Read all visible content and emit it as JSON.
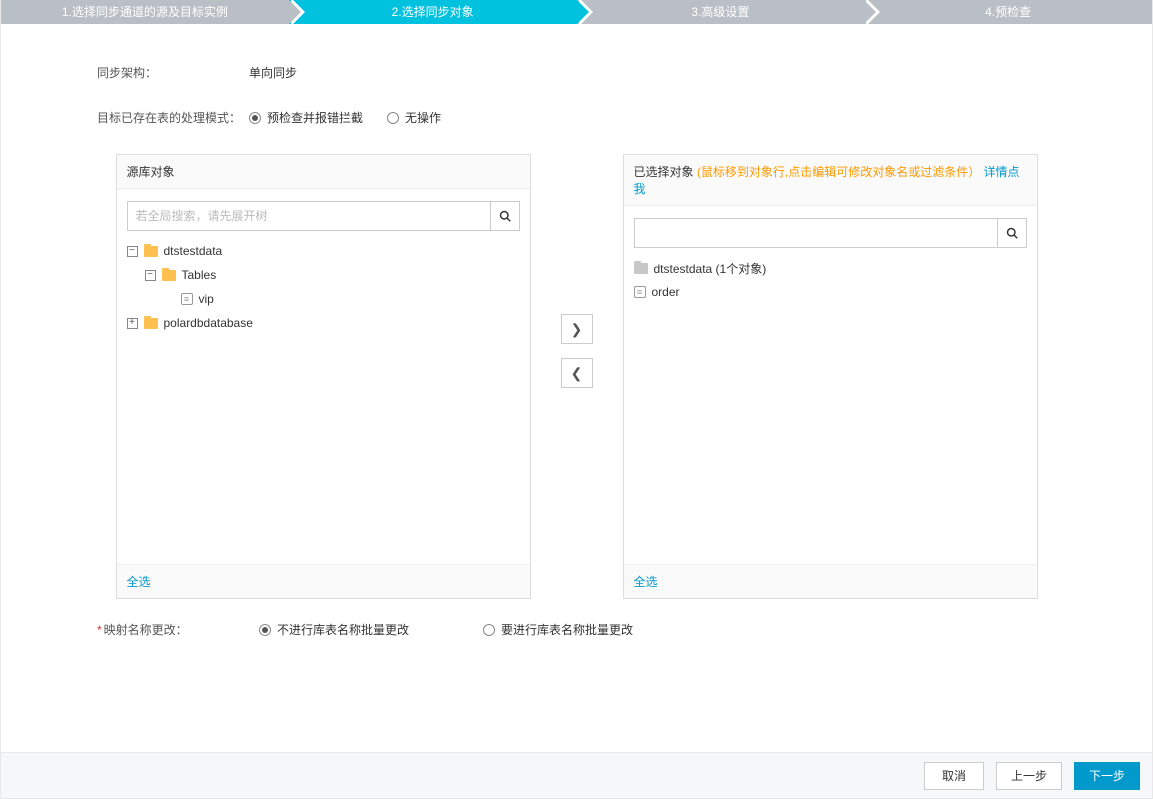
{
  "steps": [
    "1.选择同步通道的源及目标实例",
    "2.选择同步对象",
    "3.高级设置",
    "4.预检查"
  ],
  "activeStep": 1,
  "syncArch": {
    "label": "同步架构：",
    "value": "单向同步"
  },
  "targetMode": {
    "label": "目标已存在表的处理模式：",
    "options": [
      "预检查并报错拦截",
      "无操作"
    ],
    "selected": 0
  },
  "sourcePanel": {
    "title": "源库对象",
    "searchPlaceholder": "若全局搜索，请先展开树",
    "selectAll": "全选",
    "tree": {
      "db1": {
        "name": "dtstestdata",
        "open": true
      },
      "tables": {
        "name": "Tables",
        "open": true
      },
      "vip": {
        "name": "vip"
      },
      "db2": {
        "name": "polardbdatabase",
        "open": false
      }
    }
  },
  "selectedPanel": {
    "title": "已选择对象",
    "hint": "(鼠标移到对象行,点击编辑可修改对象名或过滤条件）",
    "link": "详情点我",
    "selectAll": "全选",
    "items": {
      "db": "dtstestdata (1个对象)",
      "order": "order"
    }
  },
  "moveBtns": {
    "right": "❯",
    "left": "❮"
  },
  "nameMap": {
    "label": "映射名称更改：",
    "options": [
      "不进行库表名称批量更改",
      "要进行库表名称批量更改"
    ],
    "selected": 0
  },
  "footer": {
    "cancel": "取消",
    "prev": "上一步",
    "next": "下一步"
  }
}
